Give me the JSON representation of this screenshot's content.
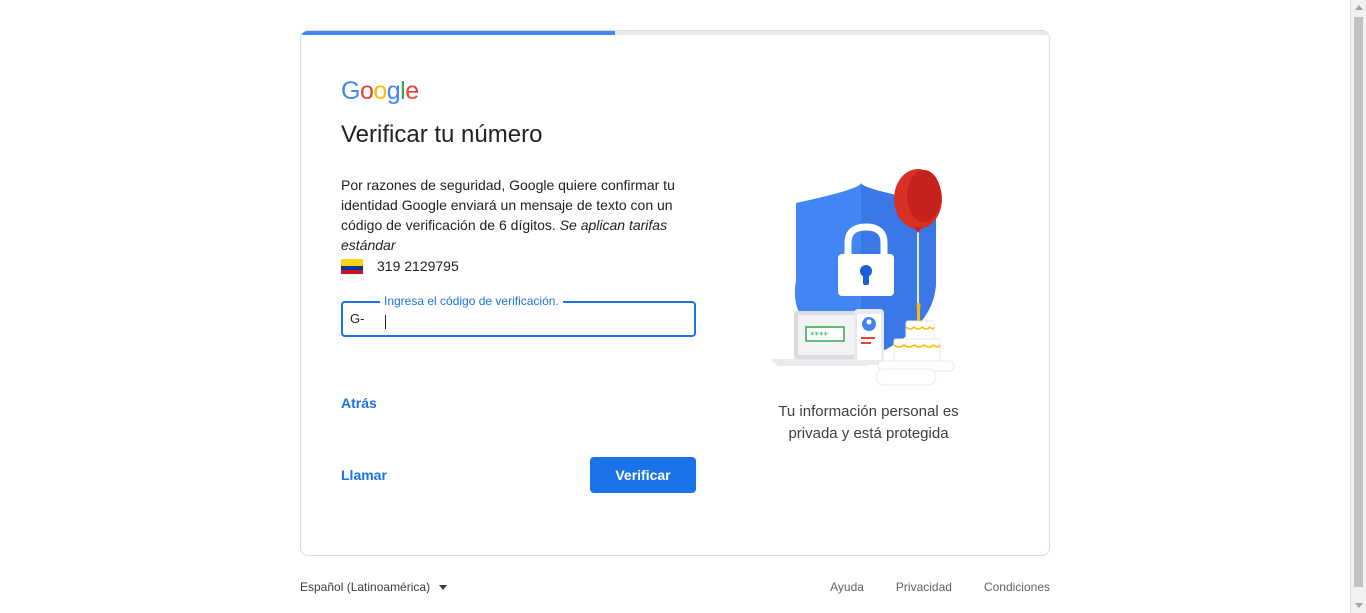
{
  "progress": {
    "fraction": 0.42,
    "fill_color": "#4285f4"
  },
  "logo": {
    "letters": [
      "G",
      "o",
      "o",
      "g",
      "l",
      "e"
    ],
    "colors": [
      "#4285f4",
      "#ea4335",
      "#fbbc05",
      "#4285f4",
      "#34a853",
      "#ea4335"
    ]
  },
  "page": {
    "title": "Verificar tu número",
    "description": "Por razones de seguridad, Google quiere confirmar tu identidad Google enviará un mensaje de texto con un código de verificación de 6 dígitos.",
    "description_note": "Se aplican tarifas estándar",
    "phone_number": "319 2129795",
    "flag_icon": "colombia-flag-icon"
  },
  "code_field": {
    "prefix": "G-",
    "label": "Ingresa el código de verificación.",
    "value": ""
  },
  "actions": {
    "back_label": "Atrás",
    "call_label": "Llamar",
    "verify_label": "Verificar"
  },
  "illustration": {
    "caption": "Tu información personal es privada y está protegida",
    "icon": "shield-lock-balloon-illustration"
  },
  "footer": {
    "language": "Español (Latinoamérica)",
    "links": [
      "Ayuda",
      "Privacidad",
      "Condiciones"
    ]
  },
  "colors": {
    "accent": "#1a73e8"
  }
}
